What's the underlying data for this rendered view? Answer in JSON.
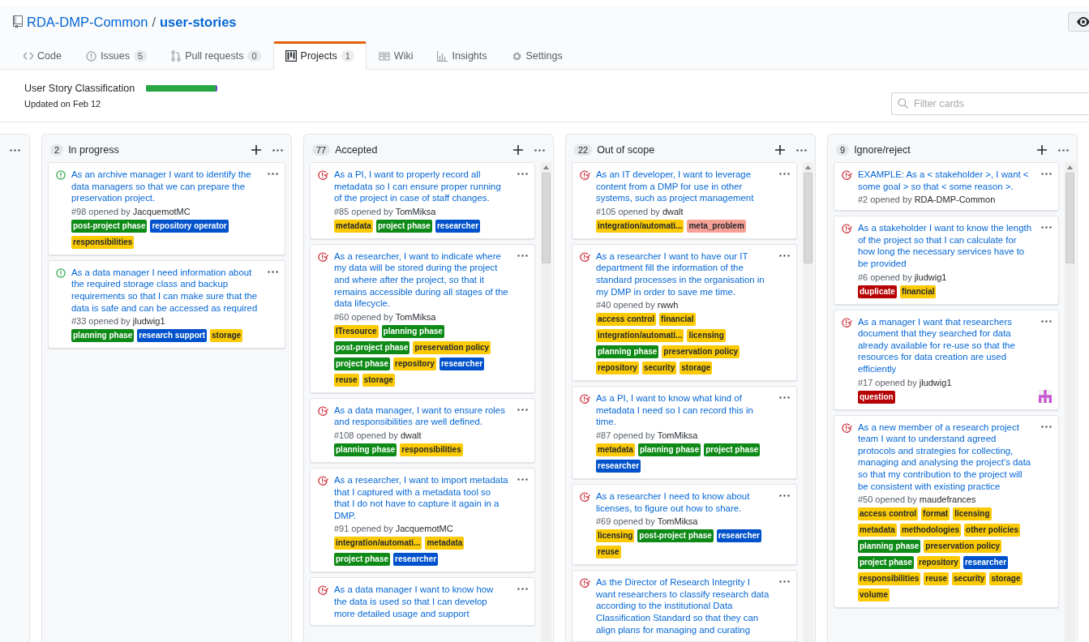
{
  "repo": {
    "owner": "RDA-DMP-Common",
    "separator": "/",
    "name": "user-stories"
  },
  "tabs": [
    {
      "label": "Code",
      "selected": false
    },
    {
      "label": "Issues",
      "count": "5",
      "selected": false
    },
    {
      "label": "Pull requests",
      "count": "0",
      "selected": false
    },
    {
      "label": "Projects",
      "count": "1",
      "selected": true
    },
    {
      "label": "Wiki",
      "selected": false
    },
    {
      "label": "Insights",
      "selected": false
    },
    {
      "label": "Settings",
      "selected": false
    }
  ],
  "project": {
    "title": "User Story Classification",
    "level": 0.98,
    "updated": "Updated on Feb 12"
  },
  "filter": {
    "placeholder": "Filter cards"
  },
  "columns": [
    {
      "count": "2",
      "name": "In progress",
      "cards": [
        {
          "closed": false,
          "title": "As an archive manager I want to identify the data managers so that we can prepare the preservation project.",
          "number": "#98",
          "opened": "opened by",
          "author": "JacquemotMC",
          "avatar": false,
          "labels": [
            {
              "name": "post-project phase",
              "color": "#0e8a16"
            },
            {
              "name": "repository operator",
              "color": "#0052cc"
            },
            {
              "name": "responsibilities",
              "color": "#fbca04"
            }
          ]
        },
        {
          "closed": false,
          "title": "As a data manager I need information about the required storage class and backup requirements so that I can make sure that the data is safe and can be accessed as required",
          "number": "#33",
          "opened": "opened by",
          "author": "jludwig1",
          "avatar": false,
          "labels": [
            {
              "name": "planning phase",
              "color": "#0e8a16"
            },
            {
              "name": "research support",
              "color": "#0052cc"
            },
            {
              "name": "storage",
              "color": "#fbca04"
            }
          ]
        }
      ]
    },
    {
      "count": "77",
      "name": "Accepted",
      "cards": [
        {
          "closed": true,
          "title": "As a PI, I want to properly record all metadata so I can ensure proper running of the project in case of staff changes.",
          "number": "#85",
          "opened": "opened by",
          "author": "TomMiksa",
          "avatar": false,
          "labels": [
            {
              "name": "metadata",
              "color": "#fbca04"
            },
            {
              "name": "project phase",
              "color": "#0e8a16"
            },
            {
              "name": "researcher",
              "color": "#0052cc"
            }
          ]
        },
        {
          "closed": true,
          "title": "As a researcher, I want to indicate where my data will be stored during the project and where after the project, so that it remains accessible during all stages of the data lifecycle.",
          "number": "#60",
          "opened": "opened by",
          "author": "TomMiksa",
          "avatar": false,
          "labels": [
            {
              "name": "ITresource",
              "color": "#fbca04"
            },
            {
              "name": "planning phase",
              "color": "#0e8a16"
            },
            {
              "name": "post-project phase",
              "color": "#0e8a16"
            },
            {
              "name": "preservation policy",
              "color": "#fbca04"
            },
            {
              "name": "project phase",
              "color": "#0e8a16"
            },
            {
              "name": "repository",
              "color": "#fbca04"
            },
            {
              "name": "researcher",
              "color": "#0052cc"
            },
            {
              "name": "reuse",
              "color": "#fbca04"
            },
            {
              "name": "storage",
              "color": "#fbca04"
            }
          ]
        },
        {
          "closed": true,
          "title": "As a data manager, I want to ensure roles and responsibilities are well defined.",
          "number": "#108",
          "opened": "opened by",
          "author": "dwalt",
          "avatar": false,
          "labels": [
            {
              "name": "planning phase",
              "color": "#0e8a16"
            },
            {
              "name": "responsibilities",
              "color": "#fbca04"
            }
          ]
        },
        {
          "closed": true,
          "title": "As a researcher, I want to import metadata that I captured with a metadata tool so that I do not have to capture it again in a DMP.",
          "number": "#91",
          "opened": "opened by",
          "author": "JacquemotMC",
          "avatar": false,
          "labels": [
            {
              "name": "integration/automati...",
              "color": "#fbca04"
            },
            {
              "name": "metadata",
              "color": "#fbca04"
            },
            {
              "name": "project phase",
              "color": "#0e8a16"
            },
            {
              "name": "researcher",
              "color": "#0052cc"
            }
          ]
        },
        {
          "closed": true,
          "title": "As a data manager I want to know how the data is used so that I can develop more detailed usage and support",
          "avatar": false
        }
      ]
    },
    {
      "count": "22",
      "name": "Out of scope",
      "cards": [
        {
          "closed": true,
          "title": "As an IT developer, I want to leverage content from a DMP for use in other systems, such as project management",
          "number": "#105",
          "opened": "opened by",
          "author": "dwalt",
          "avatar": false,
          "labels": [
            {
              "name": "integration/automati...",
              "color": "#fbca04"
            },
            {
              "name": "meta_problem",
              "color": "#f7a196"
            }
          ]
        },
        {
          "closed": true,
          "title": "As a researcher I want to have our IT department fill the information of the standard processes in the organisation in my DMP in order to save me time.",
          "number": "#40",
          "opened": "opened by",
          "author": "rwwh",
          "avatar": false,
          "labels": [
            {
              "name": "access control",
              "color": "#fbca04"
            },
            {
              "name": "financial",
              "color": "#fbca04"
            },
            {
              "name": "integration/automati...",
              "color": "#fbca04"
            },
            {
              "name": "licensing",
              "color": "#fbca04"
            },
            {
              "name": "planning phase",
              "color": "#0e8a16"
            },
            {
              "name": "preservation policy",
              "color": "#fbca04"
            },
            {
              "name": "repository",
              "color": "#fbca04"
            },
            {
              "name": "security",
              "color": "#fbca04"
            },
            {
              "name": "storage",
              "color": "#fbca04"
            }
          ]
        },
        {
          "closed": true,
          "title": "As a PI, I want to know what kind of metadata I need so I can record this in time.",
          "number": "#87",
          "opened": "opened by",
          "author": "TomMiksa",
          "avatar": false,
          "labels": [
            {
              "name": "metadata",
              "color": "#fbca04"
            },
            {
              "name": "planning phase",
              "color": "#0e8a16"
            },
            {
              "name": "project phase",
              "color": "#0e8a16"
            },
            {
              "name": "researcher",
              "color": "#0052cc"
            }
          ]
        },
        {
          "closed": true,
          "title": "As a researcher I need to know about licenses, to figure out how to share.",
          "number": "#69",
          "opened": "opened by",
          "author": "TomMiksa",
          "avatar": false,
          "labels": [
            {
              "name": "licensing",
              "color": "#fbca04"
            },
            {
              "name": "post-project phase",
              "color": "#0e8a16"
            },
            {
              "name": "researcher",
              "color": "#0052cc"
            },
            {
              "name": "reuse",
              "color": "#fbca04"
            }
          ]
        },
        {
          "closed": true,
          "title": "As the Director of Research Integrity I want researchers to classify research data according to the institutional Data Classification Standard so that they can align plans for managing and curating",
          "avatar": false
        }
      ]
    },
    {
      "count": "9",
      "name": "Ignore/reject",
      "cards": [
        {
          "closed": true,
          "title": "EXAMPLE: As a < stakeholder >, I want < some goal > so that < some reason >.",
          "number": "#2",
          "opened": "opened by",
          "author": "RDA-DMP-Common",
          "avatar": false
        },
        {
          "closed": true,
          "title": "As a stakeholder I want to know the length of the project so that I can calculate for how long the necessary services have to be provided",
          "number": "#6",
          "opened": "opened by",
          "author": "jludwig1",
          "avatar": false,
          "labels": [
            {
              "name": "duplicate",
              "color": "#b60205"
            },
            {
              "name": "financial",
              "color": "#fbca04"
            }
          ]
        },
        {
          "closed": true,
          "title": "As a manager I want that researchers document that they searched for data already available for re-use so that the resources for data creation are used efficiently",
          "number": "#17",
          "opened": "opened by",
          "author": "jludwig1",
          "avatar": true,
          "labels": [
            {
              "name": "question",
              "color": "#b60205"
            }
          ]
        },
        {
          "closed": true,
          "title": "As a new member of a research project team I want to understand agreed protocols and strategies for collecting, managing and analysing the project’s data so that my contribution to the project will be consistent with existing practice",
          "number": "#50",
          "opened": "opened by",
          "author": "maudefrances",
          "avatar": false,
          "labels": [
            {
              "name": "access control",
              "color": "#fbca04"
            },
            {
              "name": "format",
              "color": "#fbca04"
            },
            {
              "name": "licensing",
              "color": "#fbca04"
            },
            {
              "name": "metadata",
              "color": "#fbca04"
            },
            {
              "name": "methodologies",
              "color": "#fbca04"
            },
            {
              "name": "other policies",
              "color": "#fbca04"
            },
            {
              "name": "planning phase",
              "color": "#0e8a16"
            },
            {
              "name": "preservation policy",
              "color": "#fbca04"
            },
            {
              "name": "project phase",
              "color": "#0e8a16"
            },
            {
              "name": "repository",
              "color": "#fbca04"
            },
            {
              "name": "researcher",
              "color": "#0052cc"
            },
            {
              "name": "responsibilities",
              "color": "#fbca04"
            },
            {
              "name": "reuse",
              "color": "#fbca04"
            },
            {
              "name": "security",
              "color": "#fbca04"
            },
            {
              "name": "storage",
              "color": "#fbca04"
            },
            {
              "name": "volume",
              "color": "#fbca04"
            }
          ]
        }
      ]
    }
  ]
}
